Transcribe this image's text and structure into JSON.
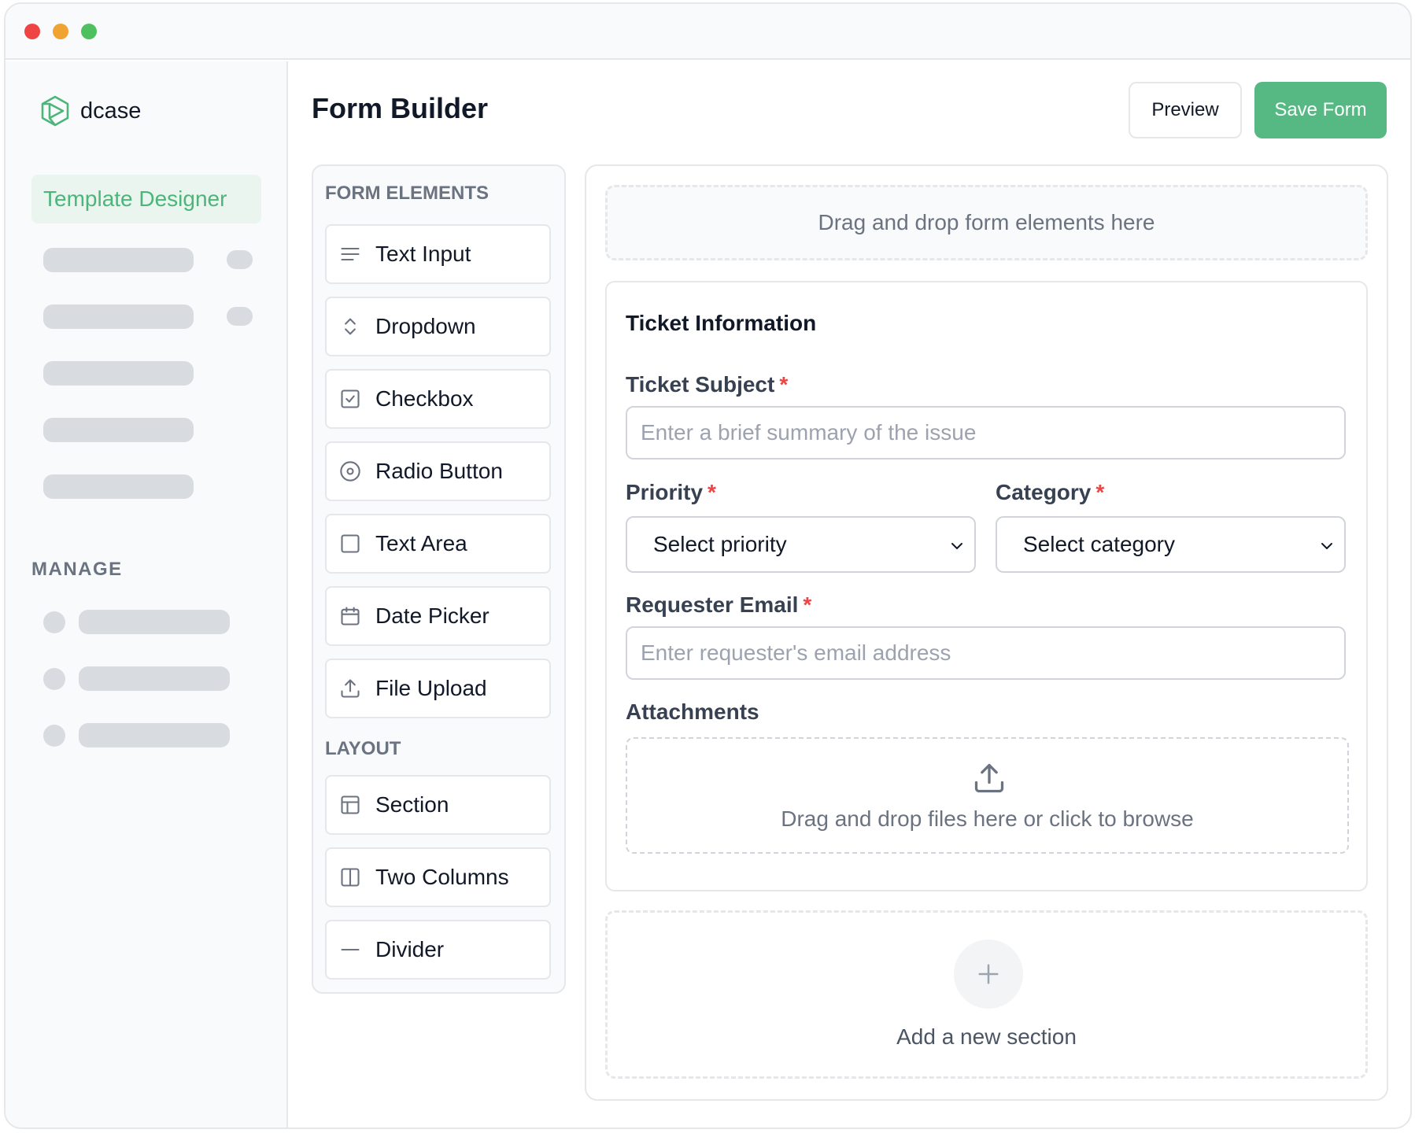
{
  "app": {
    "brand": "dcase",
    "accent": "#56b983",
    "brand_logo": "dcase-logo-icon"
  },
  "sidebar": {
    "active_item": "Template Designer",
    "manage_title": "MANAGE"
  },
  "header": {
    "title": "Form Builder",
    "preview_label": "Preview",
    "save_label": "Save Form"
  },
  "palette": {
    "form_elements_title": "FORM ELEMENTS",
    "form_elements": [
      {
        "label": "Text Input",
        "icon": "lines-icon"
      },
      {
        "label": "Dropdown",
        "icon": "chevron-up-down-icon"
      },
      {
        "label": "Checkbox",
        "icon": "checkbox-icon"
      },
      {
        "label": "Radio Button",
        "icon": "radio-icon"
      },
      {
        "label": "Text Area",
        "icon": "square-icon"
      },
      {
        "label": "Date Picker",
        "icon": "calendar-icon"
      },
      {
        "label": "File Upload",
        "icon": "upload-icon"
      }
    ],
    "layout_title": "LAYOUT",
    "layout_elements": [
      {
        "label": "Section",
        "icon": "section-layout-icon"
      },
      {
        "label": "Two Columns",
        "icon": "columns-icon"
      },
      {
        "label": "Divider",
        "icon": "minus-icon"
      }
    ]
  },
  "canvas": {
    "dropzone_text": "Drag and drop form elements here",
    "section": {
      "title": "Ticket Information",
      "required_mark": "*",
      "subject": {
        "label": "Ticket Subject",
        "placeholder": "Enter a brief summary of the issue"
      },
      "priority": {
        "label": "Priority",
        "value": "Select priority"
      },
      "category": {
        "label": "Category",
        "value": "Select category"
      },
      "email": {
        "label": "Requester Email",
        "placeholder": "Enter requester's email address"
      },
      "attachments": {
        "label": "Attachments",
        "upload_text": "Drag and drop files here or click to browse"
      }
    },
    "add_section_text": "Add a new section"
  }
}
